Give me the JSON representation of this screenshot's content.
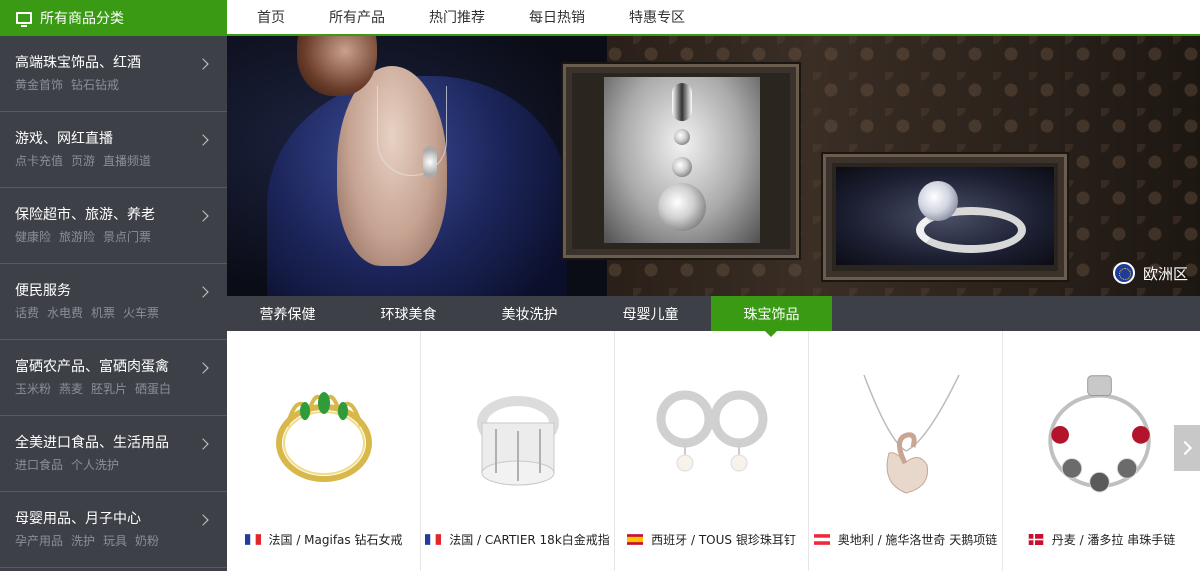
{
  "sidebar": {
    "header": "所有商品分类",
    "categories": [
      {
        "title": "高端珠宝饰品、红酒",
        "subs": [
          "黄金首饰",
          "钻石钻戒"
        ]
      },
      {
        "title": "游戏、网红直播",
        "subs": [
          "点卡充值",
          "页游",
          "直播频道"
        ]
      },
      {
        "title": "保险超市、旅游、养老",
        "subs": [
          "健康险",
          "旅游险",
          "景点门票"
        ]
      },
      {
        "title": "便民服务",
        "subs": [
          "话费",
          "水电费",
          "机票",
          "火车票"
        ]
      },
      {
        "title": "富硒农产品、富硒肉蛋禽",
        "subs": [
          "玉米粉",
          "燕麦",
          "胚乳片",
          "硒蛋白"
        ]
      },
      {
        "title": "全美进口食品、生活用品",
        "subs": [
          "进口食品",
          "个人洗护"
        ]
      },
      {
        "title": "母婴用品、月子中心",
        "subs": [
          "孕产用品",
          "洗护",
          "玩具",
          "奶粉"
        ]
      }
    ]
  },
  "topnav": {
    "items": [
      "首页",
      "所有产品",
      "热门推荐",
      "每日热销",
      "特惠专区"
    ]
  },
  "banner": {
    "region_label": "欧洲区"
  },
  "tabs": {
    "items": [
      "营养保健",
      "环球美食",
      "美妆洗护",
      "母婴儿童",
      "珠宝饰品"
    ],
    "active_index": 4
  },
  "products": [
    {
      "country": "法国",
      "caption": "法国 / Magifas  钻石女戒",
      "flag": "france"
    },
    {
      "country": "法国",
      "caption": "法国 / CARTIER 18k白金戒指",
      "flag": "france"
    },
    {
      "country": "西班牙",
      "caption": "西班牙 / TOUS 银珍珠耳钉",
      "flag": "spain"
    },
    {
      "country": "奥地利",
      "caption": "奥地利 / 施华洛世奇 天鹅项链",
      "flag": "austria"
    },
    {
      "country": "丹麦",
      "caption": "丹麦 /  潘多拉 串珠手链",
      "flag": "denmark"
    }
  ],
  "colors": {
    "accent": "#3a9a13",
    "sidebar_bg": "#3d4147",
    "tab_bg": "#3d4147"
  }
}
